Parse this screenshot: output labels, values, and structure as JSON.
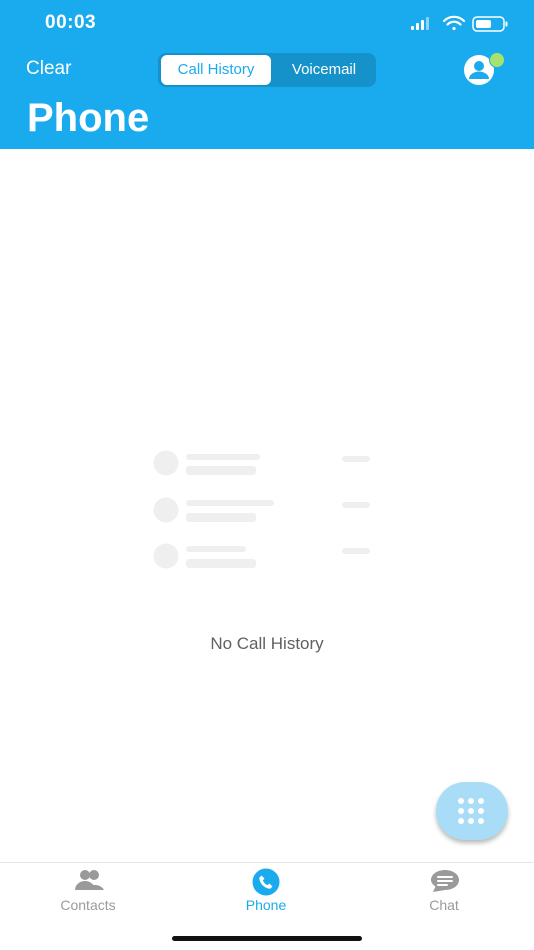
{
  "status_bar": {
    "time": "00:03"
  },
  "header": {
    "clear_label": "Clear",
    "title": "Phone",
    "segments": [
      {
        "label": "Call History",
        "selected": true
      },
      {
        "label": "Voicemail",
        "selected": false
      }
    ],
    "avatar_icon": "user-icon",
    "presence_color": "#a5e36c"
  },
  "main": {
    "empty_state_text": "No Call History",
    "dialpad_icon": "dialpad-icon"
  },
  "tabbar": {
    "items": [
      {
        "label": "Contacts",
        "icon": "contacts-icon",
        "active": false
      },
      {
        "label": "Phone",
        "icon": "phone-icon",
        "active": true
      },
      {
        "label": "Chat",
        "icon": "chat-icon",
        "active": false
      }
    ]
  },
  "colors": {
    "accent": "#1aabee",
    "segment_track": "#1492c9",
    "fab": "#a9dcf6",
    "inactive_tab": "#9a9a9a"
  }
}
